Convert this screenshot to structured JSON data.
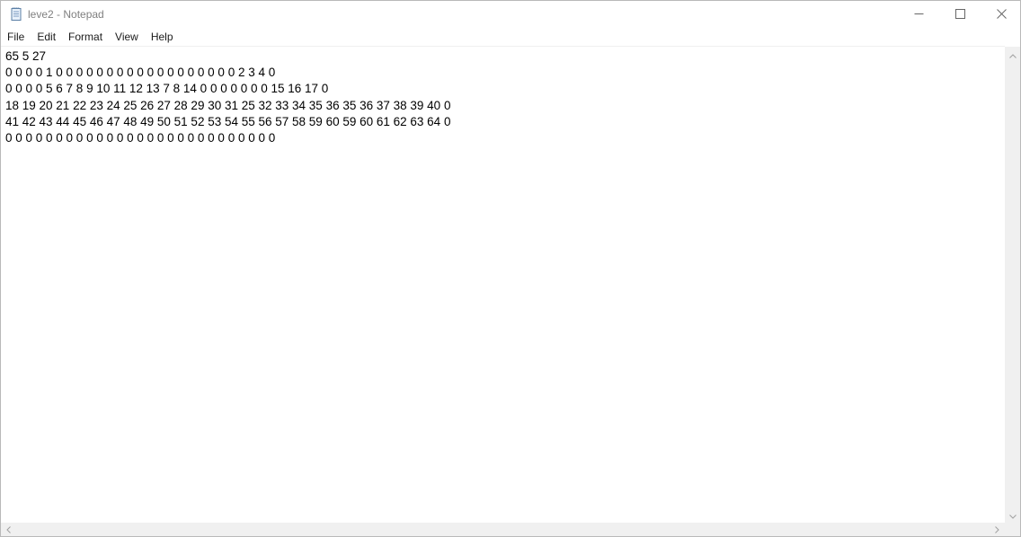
{
  "window": {
    "title": "leve2 - Notepad",
    "icon": "notepad-icon"
  },
  "title_buttons": {
    "minimize": "minimize-icon",
    "maximize": "maximize-icon",
    "close": "close-icon"
  },
  "menu": {
    "items": [
      {
        "label": "File"
      },
      {
        "label": "Edit"
      },
      {
        "label": "Format"
      },
      {
        "label": "View"
      },
      {
        "label": "Help"
      }
    ]
  },
  "editor": {
    "lines": [
      "65 5 27",
      "0 0 0 0 1 0 0 0 0 0 0 0 0 0 0 0 0 0 0 0 0 0 0 2 3 4 0",
      "0 0 0 0 5 6 7 8 9 10 11 12 13 7 8 14 0 0 0 0 0 0 0 15 16 17 0",
      "18 19 20 21 22 23 24 25 26 27 28 29 30 31 25 32 33 34 35 36 35 36 37 38 39 40 0",
      "41 42 43 44 45 46 47 48 49 50 51 52 53 54 55 56 57 58 59 60 59 60 61 62 63 64 0",
      "0 0 0 0 0 0 0 0 0 0 0 0 0 0 0 0 0 0 0 0 0 0 0 0 0 0 0"
    ]
  },
  "colors": {
    "title_text": "#808080",
    "menu_text": "#1b1b1b",
    "scrollbar_bg": "#f0f0f0",
    "icon_gray": "#666666"
  }
}
